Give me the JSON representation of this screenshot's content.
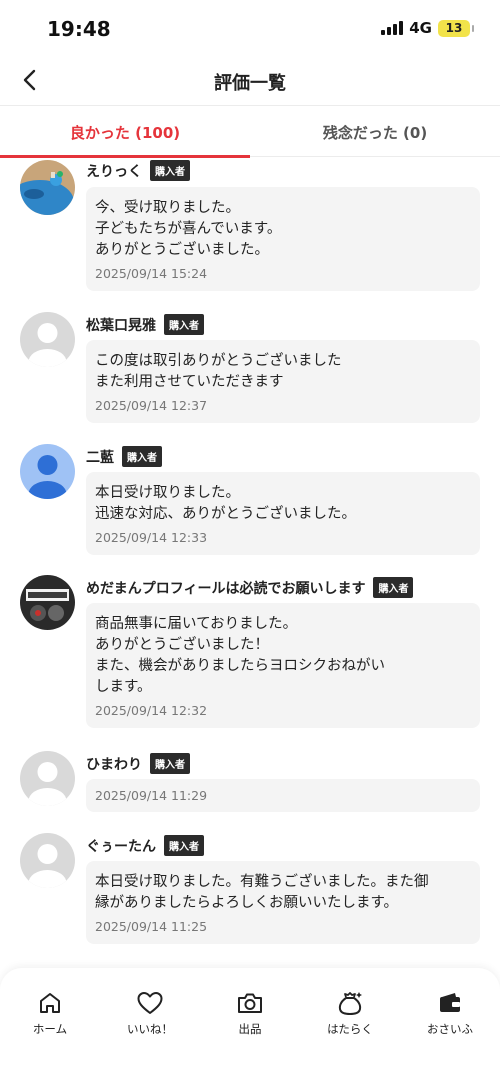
{
  "status": {
    "time": "19:48",
    "network": "4G",
    "battery": "13"
  },
  "header": {
    "title": "評価一覧",
    "back_icon": "chevron-left-icon"
  },
  "tabs": [
    {
      "label": "良かった (100)",
      "active": true
    },
    {
      "label": "残念だった (0)",
      "active": false
    }
  ],
  "reviews": [
    {
      "name": "えりっく",
      "badge": "購入者",
      "lines": [
        "今、受け取りました。",
        "子どもたちが喜んでいます。",
        "ありがとうございました。"
      ],
      "date": "2025/09/14 15:24",
      "avatar": "photo-blue-toy"
    },
    {
      "name": "松葉口晃雅",
      "badge": "購入者",
      "lines": [
        "この度は取引ありがとうございました",
        "また利用させていただきます"
      ],
      "date": "2025/09/14 12:37",
      "avatar": "default-gray"
    },
    {
      "name": "二藍",
      "badge": "購入者",
      "lines": [
        "本日受け取りました。",
        "迅速な対応、ありがとうございました。"
      ],
      "date": "2025/09/14 12:33",
      "avatar": "default-blue"
    },
    {
      "name": "めだまんプロフィールは必読でお願いします",
      "badge": "購入者",
      "lines": [
        "商品無事に届いておりました。",
        "ありがとうございました！",
        "また、機会がありましたらヨロシクおねがい",
        "します。"
      ],
      "date": "2025/09/14 12:32",
      "avatar": "photo-dark"
    },
    {
      "name": "ひまわり",
      "badge": "購入者",
      "lines": [],
      "date": "2025/09/14 11:29",
      "avatar": "default-gray"
    },
    {
      "name": "ぐぅーたん",
      "badge": "購入者",
      "lines": [
        "本日受け取りました。有難うございました。また御",
        "縁がありましたらよろしくお願いいたします。"
      ],
      "date": "2025/09/14 11:25",
      "avatar": "default-gray"
    }
  ],
  "nav": [
    {
      "label": "ホーム",
      "icon": "home-icon"
    },
    {
      "label": "いいね！",
      "icon": "heart-icon"
    },
    {
      "label": "出品",
      "icon": "camera-icon"
    },
    {
      "label": "はたらく",
      "icon": "money-bag-icon"
    },
    {
      "label": "おさいふ",
      "icon": "wallet-icon"
    }
  ],
  "colors": {
    "accent": "#e5343b",
    "bubble": "#f4f4f4",
    "badge": "#2b2b2b"
  }
}
